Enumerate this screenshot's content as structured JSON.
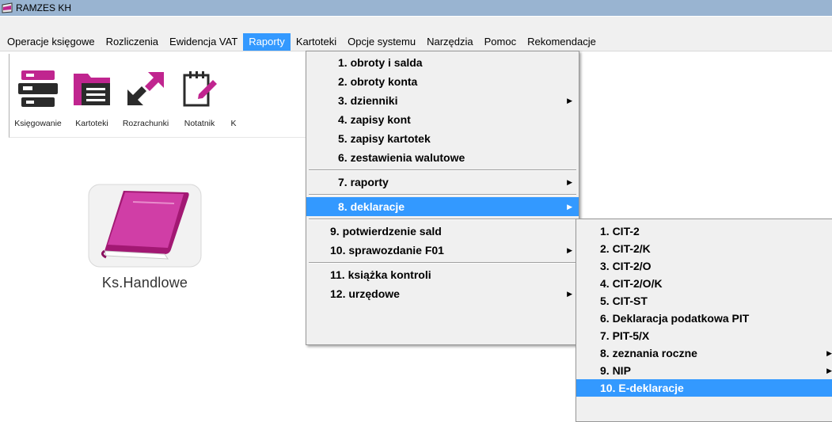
{
  "window": {
    "title": "RAMZES KH",
    "icon": "ramzes-app-icon"
  },
  "menubar": {
    "items": [
      {
        "label": "Operacje księgowe"
      },
      {
        "label": "Rozliczenia"
      },
      {
        "label": "Ewidencja VAT"
      },
      {
        "label": "Raporty",
        "active": true
      },
      {
        "label": "Kartoteki"
      },
      {
        "label": "Opcje systemu"
      },
      {
        "label": "Narzędzia"
      },
      {
        "label": "Pomoc"
      },
      {
        "label": "Rekomendacje"
      }
    ]
  },
  "toolbar": {
    "items": [
      {
        "label": "Księgowanie",
        "icon": "ledger-icon"
      },
      {
        "label": "Kartoteki",
        "icon": "folder-icon"
      },
      {
        "label": "Rozrachunki",
        "icon": "arrows-icon"
      },
      {
        "label": "Notatnik",
        "icon": "notepad-icon"
      },
      {
        "label": "K",
        "icon": "partial-icon"
      }
    ]
  },
  "desktop": {
    "icon_label": "Ks.Handlowe",
    "icon": "book-icon"
  },
  "raporty_menu": {
    "items": [
      {
        "label": "1.  obroty i salda"
      },
      {
        "label": "2.  obroty konta"
      },
      {
        "label": "3.  dzienniki",
        "submenu": true
      },
      {
        "label": "4.  zapisy kont"
      },
      {
        "label": "5.  zapisy kartotek"
      },
      {
        "label": "6.  zestawienia walutowe"
      },
      {
        "label": "7.  raporty",
        "submenu": true
      },
      {
        "label": "8.  deklaracje",
        "submenu": true,
        "active": true
      },
      {
        "label": "9.  potwierdzenie sald"
      },
      {
        "label": "10.  sprawozdanie F01",
        "submenu": true
      },
      {
        "label": "11. książka kontroli"
      },
      {
        "label": "12. urzędowe",
        "submenu": true
      }
    ]
  },
  "deklaracje_menu": {
    "items": [
      {
        "label": "1.  CIT-2"
      },
      {
        "label": "2.  CIT-2/K"
      },
      {
        "label": "3.  CIT-2/O"
      },
      {
        "label": "4.  CIT-2/O/K"
      },
      {
        "label": "5.  CIT-ST"
      },
      {
        "label": "6.  Deklaracja podatkowa PIT"
      },
      {
        "label": "7.  PIT-5/X"
      },
      {
        "label": "8.  zeznania roczne",
        "submenu": true
      },
      {
        "label": "9.  NIP",
        "submenu": true
      },
      {
        "label": "10. E-deklaracje",
        "active": true
      }
    ]
  },
  "colors": {
    "highlight": "#3399ff",
    "accent_magenta": "#c0258f",
    "menu_bg": "#f0f0f0"
  },
  "arrow_glyph": "▶"
}
